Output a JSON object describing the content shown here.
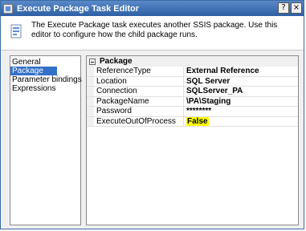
{
  "window": {
    "title": "Execute Package Task Editor"
  },
  "titlebar_buttons": {
    "help": "?",
    "close": "×"
  },
  "header": {
    "description": "The Execute Package task executes another SSIS package. Use this editor to configure how the child package runs."
  },
  "nav": {
    "items": [
      {
        "label": "General"
      },
      {
        "label": "Package"
      },
      {
        "label": "Parameter bindings"
      },
      {
        "label": "Expressions"
      }
    ],
    "selected": "Package"
  },
  "grid": {
    "category": "Package",
    "rows": [
      {
        "name": "ReferenceType",
        "value": "External Reference"
      },
      {
        "name": "Location",
        "value": "SQL Server"
      },
      {
        "name": "Connection",
        "value": "SQLServer_PA"
      },
      {
        "name": "PackageName",
        "value": "\\PA\\Staging"
      },
      {
        "name": "Password",
        "value": "********"
      },
      {
        "name": "ExecuteOutOfProcess",
        "value": "False"
      }
    ]
  },
  "colors": {
    "title_bar": "#2d5fa3",
    "selection": "#3370c8",
    "highlight": "#ffff00"
  }
}
